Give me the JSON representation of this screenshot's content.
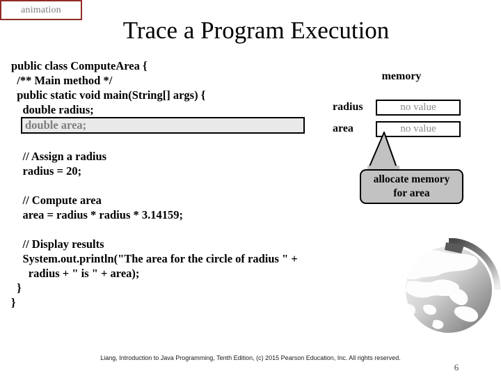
{
  "badge": {
    "label": "animation"
  },
  "title": "Trace a Program Execution",
  "code": {
    "lines": [
      {
        "text": "public class ComputeArea {",
        "highlight": false
      },
      {
        "text": "  /** Main method */",
        "highlight": false
      },
      {
        "text": "  public static void main(String[] args) {",
        "highlight": false
      },
      {
        "text": "    double radius;",
        "highlight": false
      },
      {
        "text": "double area;",
        "highlight": true
      },
      {
        "text": "",
        "highlight": false
      },
      {
        "text": "    // Assign a radius",
        "highlight": false
      },
      {
        "text": "    radius = 20;",
        "highlight": false
      },
      {
        "text": "",
        "highlight": false
      },
      {
        "text": "    // Compute area",
        "highlight": false
      },
      {
        "text": "    area = radius * radius * 3.14159;",
        "highlight": false
      },
      {
        "text": "",
        "highlight": false
      },
      {
        "text": "    // Display results",
        "highlight": false
      },
      {
        "text": "    System.out.println(\"The area for the circle of radius \" +",
        "highlight": false
      },
      {
        "text": "      radius + \" is \" + area);",
        "highlight": false
      },
      {
        "text": "  }",
        "highlight": false
      },
      {
        "text": "}",
        "highlight": false
      }
    ]
  },
  "memory": {
    "title": "memory",
    "variables": [
      {
        "name": "radius",
        "value": "no value"
      },
      {
        "name": "area",
        "value": "no value"
      }
    ]
  },
  "callout": {
    "line1": "allocate memory",
    "line2": "for area"
  },
  "footer": {
    "credit": "Liang, Introduction to Java Programming, Tenth Edition, (c) 2015 Pearson Education, Inc. All rights reserved.",
    "page_number": "6"
  },
  "colors": {
    "badge_border": "#912c24",
    "badge_text": "#7d7d7d",
    "highlight_fill": "#e9e9e9",
    "highlight_text": "#7e7e7e",
    "memory_value_text": "#8a8a8a",
    "callout_fill": "#c2c2c2"
  }
}
